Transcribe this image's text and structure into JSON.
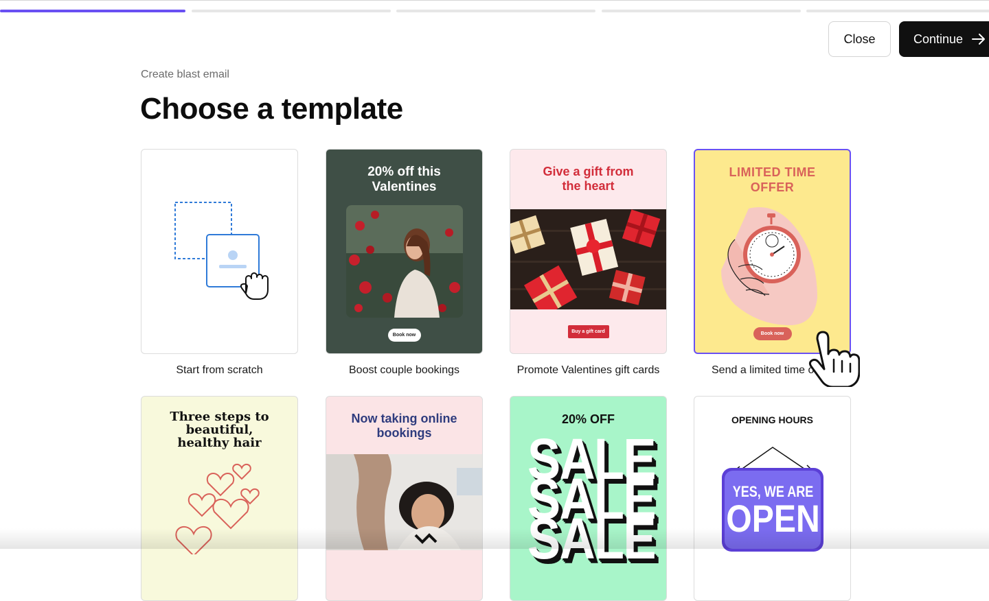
{
  "progress": {
    "total_steps": 5,
    "current_step": 1
  },
  "header": {
    "close_label": "Close",
    "continue_label": "Continue"
  },
  "page": {
    "breadcrumb": "Create blast email",
    "title": "Choose a template"
  },
  "templates": [
    {
      "caption": "Start from scratch"
    },
    {
      "caption": "Boost couple bookings",
      "heading": "20% off this Valentines",
      "button": "Book now",
      "bg": "#3f4f46"
    },
    {
      "caption": "Promote Valentines gift cards",
      "heading": "Give a gift from the heart",
      "button": "Buy a gift card",
      "bg": "#fde9ec"
    },
    {
      "caption": "Send a limited time o",
      "heading": "LIMITED TIME OFFER",
      "button": "Book now",
      "bg": "#fde98e",
      "selected": true
    },
    {
      "heading": "Three steps to beautiful, healthy hair",
      "bg": "#f8f9dc"
    },
    {
      "heading": "Now taking online bookings",
      "bg": "#fbe4e6"
    },
    {
      "heading": "20% OFF",
      "big_word": "SALE",
      "bg": "#a8f5c9"
    },
    {
      "heading": "OPENING HOURS",
      "sign_line1": "YES, WE ARE",
      "sign_line2": "OPEN",
      "bg": "#ffffff"
    }
  ],
  "colors": {
    "accent": "#6950f3",
    "primary_button": "#101010",
    "valentine_red": "#d22d3a",
    "offer_red": "#d9625a"
  }
}
